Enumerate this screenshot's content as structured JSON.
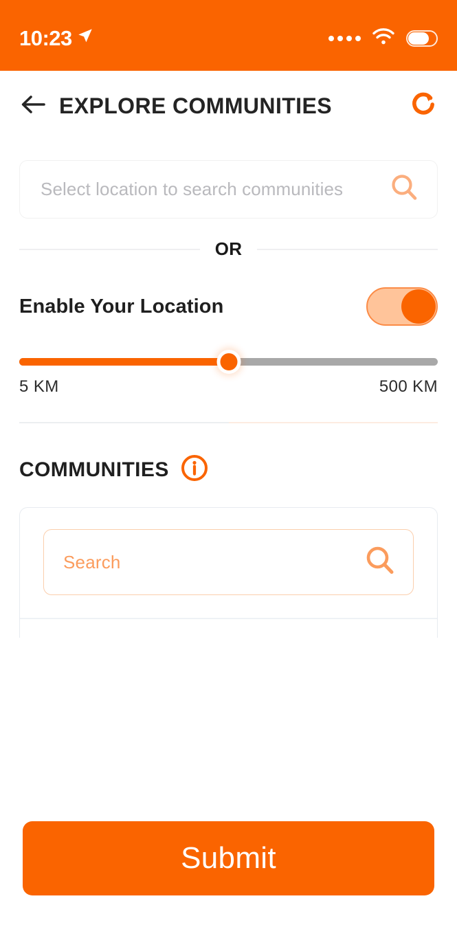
{
  "theme": {
    "accent": "#FA6400",
    "accent_light": "#FFC49A",
    "accent_pale": "#FBCEAC",
    "text_dark": "#1F1F1F",
    "placeholder_grey": "#B9B9BD",
    "track_grey": "#A8A8A8"
  },
  "status_bar": {
    "time": "10:23",
    "location_icon": "navigation-arrow-icon",
    "signal_icon": "signal-dots-icon",
    "signal_dots": 4,
    "wifi_icon": "wifi-icon",
    "battery_icon": "battery-icon"
  },
  "header": {
    "back_icon": "back-arrow-icon",
    "title": "EXPLORE COMMUNITIES",
    "refresh_icon": "refresh-icon"
  },
  "location_search": {
    "placeholder": "Select location to search communities",
    "value": "",
    "search_icon": "search-icon"
  },
  "divider": {
    "label": "OR"
  },
  "enable_location": {
    "label": "Enable Your Location",
    "toggle_state": "on"
  },
  "distance_slider": {
    "min_label": "5 KM",
    "max_label": "500 KM",
    "min": 5,
    "max": 500,
    "value_percent": 50
  },
  "communities": {
    "title": "COMMUNITIES",
    "info_icon": "info-icon",
    "search": {
      "placeholder": "Search",
      "value": "",
      "search_icon": "search-icon"
    }
  },
  "footer": {
    "submit_label": "Submit"
  }
}
